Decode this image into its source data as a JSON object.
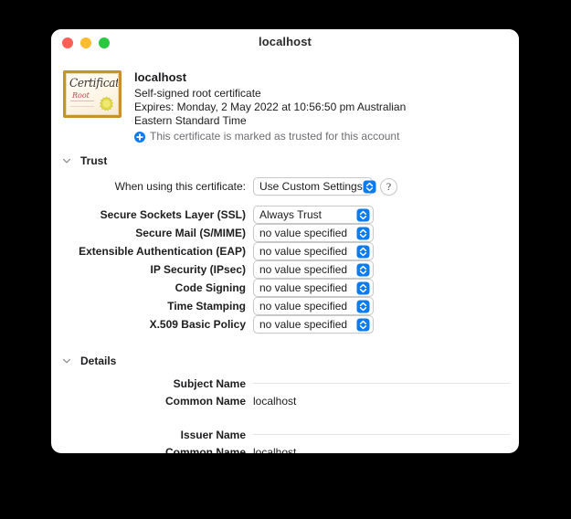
{
  "window": {
    "title": "localhost",
    "traffic_lights": [
      {
        "name": "close",
        "color": "#ff5f57"
      },
      {
        "name": "minimize",
        "color": "#febc2e"
      },
      {
        "name": "zoom",
        "color": "#28c840"
      }
    ]
  },
  "certificate": {
    "icon": {
      "name": "certificate-root-icon",
      "script_text": "Certificate",
      "root_text": "Root",
      "border_color": "#c8912c",
      "seal_color": "#e8e04a"
    },
    "name": "localhost",
    "subtitle": "Self-signed root certificate",
    "expires": "Expires: Monday, 2 May 2022 at 10:56:50 pm Australian Eastern Standard Time",
    "trusted_note": "This certificate is marked as trusted for this account",
    "trusted_badge_color": "#0a7cf0"
  },
  "trust": {
    "section_label": "Trust",
    "when_using_label": "When using this certificate:",
    "when_using_value": "Use Custom Settings",
    "help_label": "?",
    "rows": [
      {
        "label": "Secure Sockets Layer (SSL)",
        "value": "Always Trust"
      },
      {
        "label": "Secure Mail (S/MIME)",
        "value": "no value specified"
      },
      {
        "label": "Extensible Authentication (EAP)",
        "value": "no value specified"
      },
      {
        "label": "IP Security (IPsec)",
        "value": "no value specified"
      },
      {
        "label": "Code Signing",
        "value": "no value specified"
      },
      {
        "label": "Time Stamping",
        "value": "no value specified"
      },
      {
        "label": "X.509 Basic Policy",
        "value": "no value specified"
      }
    ]
  },
  "details": {
    "section_label": "Details",
    "subject_name_label": "Subject Name",
    "subject_common_name_label": "Common Name",
    "subject_common_name_value": "localhost",
    "issuer_name_label": "Issuer Name",
    "issuer_common_name_label": "Common Name",
    "issuer_common_name_value": "localhost"
  },
  "colors": {
    "accent": "#0a7cf0",
    "window_bg": "#ffffff",
    "backdrop": "#000000",
    "rule": "#e3e3e5"
  }
}
